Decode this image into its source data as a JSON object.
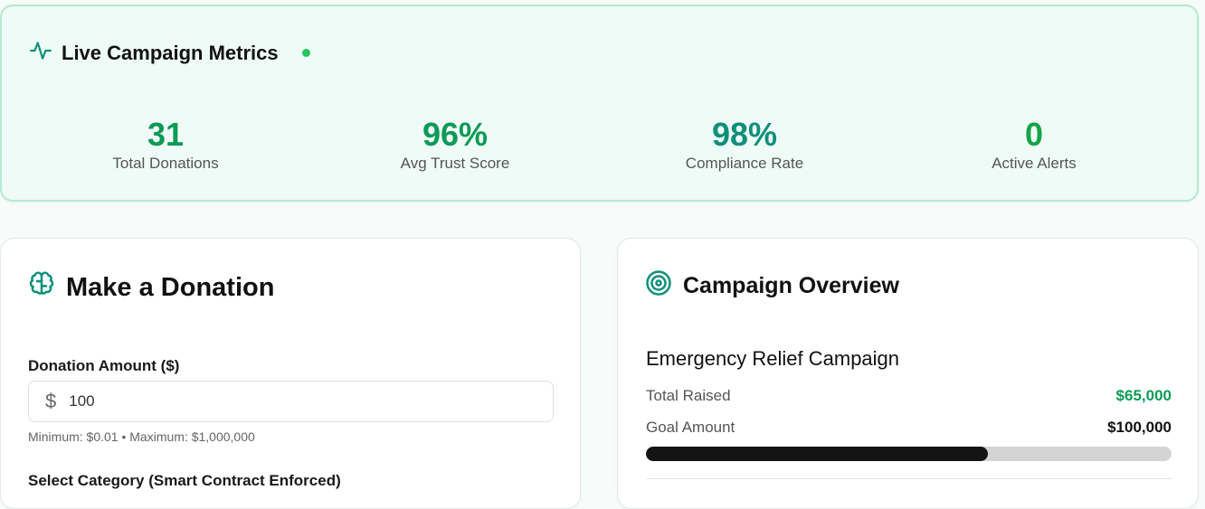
{
  "metrics": {
    "title": "Live Campaign Metrics",
    "stats": [
      {
        "value": "31",
        "label": "Total Donations",
        "color": "#0b9a57"
      },
      {
        "value": "96%",
        "label": "Avg Trust Score",
        "color": "#0b9a57"
      },
      {
        "value": "98%",
        "label": "Compliance Rate",
        "color": "#0f8f7a"
      },
      {
        "value": "0",
        "label": "Active Alerts",
        "color": "#16a34a"
      }
    ]
  },
  "donation": {
    "title": "Make a Donation",
    "amount_label": "Donation Amount ($)",
    "amount_value": "100",
    "currency_symbol": "$",
    "hint": "Minimum: $0.01 • Maximum: $1,000,000",
    "category_label": "Select Category (Smart Contract Enforced)"
  },
  "overview": {
    "title": "Campaign Overview",
    "campaign_name": "Emergency Relief Campaign",
    "raised_label": "Total Raised",
    "raised_value": "$65,000",
    "goal_label": "Goal Amount",
    "goal_value": "$100,000",
    "progress_fraction": 0.65
  },
  "colors": {
    "accent": "#0b9a57",
    "teal": "#0f8f7a"
  }
}
